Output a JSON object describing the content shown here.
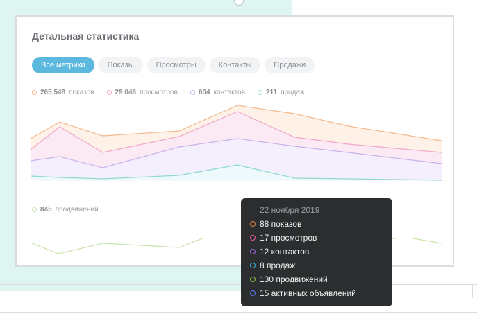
{
  "title": "Детальная статистика",
  "tabs": [
    {
      "label": "Все метрики",
      "active": true
    },
    {
      "label": "Показы",
      "active": false
    },
    {
      "label": "Просмотры",
      "active": false
    },
    {
      "label": "Контакты",
      "active": false
    },
    {
      "label": "Продажи",
      "active": false
    }
  ],
  "legend": [
    {
      "value": "265 548",
      "text": "показов",
      "color": "#f4b98c"
    },
    {
      "value": "29 046",
      "text": "просмотров",
      "color": "#f0a6c8"
    },
    {
      "value": "604",
      "text": "контактов",
      "color": "#c9b2ec"
    },
    {
      "value": "211",
      "text": "продаж",
      "color": "#8fd8cf"
    }
  ],
  "legend2": {
    "value": "845",
    "text": "продвижений",
    "color": "#c7e3a8"
  },
  "tooltip": {
    "date": "22 ноября 2019",
    "rows": [
      {
        "text": "88 показов",
        "color": "#f08a3c"
      },
      {
        "text": "17 просмотров",
        "color": "#e75aa0"
      },
      {
        "text": "12 контактов",
        "color": "#a86cf0"
      },
      {
        "text": "8 продаж",
        "color": "#3cb6e6"
      },
      {
        "text": "130 продвижений",
        "color": "#8bc34a"
      },
      {
        "text": "15 активных объявлений",
        "color": "#5b7cf0"
      }
    ]
  }
}
